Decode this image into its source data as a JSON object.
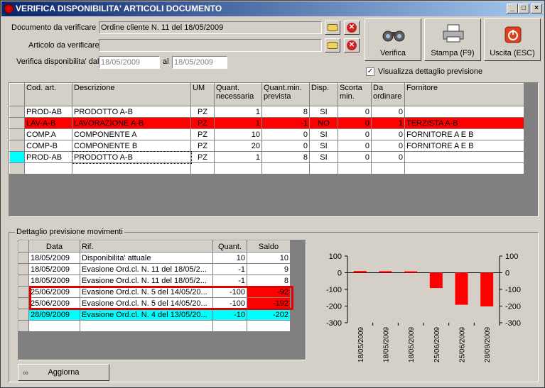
{
  "window": {
    "title": "VERIFICA DISPONIBILITA' ARTICOLI DOCUMENTO"
  },
  "form": {
    "documento_label": "Documento da verificare",
    "documento_value": "Ordine cliente N. 11 del 18/05/2009",
    "articolo_label": "Articolo da verificare",
    "articolo_value": "",
    "verifica_label": "Verifica disponibilita' dal",
    "date_from": "18/05/2009",
    "al_label": "al",
    "date_to": "18/05/2009"
  },
  "buttons": {
    "verifica": "Verifica",
    "stampa": "Stampa (F9)",
    "uscita": "Uscita (ESC)",
    "aggiorna": "Aggiorna"
  },
  "checkbox": {
    "label": "Visualizza dettaglio previsione",
    "checked": true
  },
  "grid_articoli": {
    "headers": {
      "cod": "Cod. art.",
      "descr": "Descrizione",
      "um": "UM",
      "qnec1": "Quant.",
      "qnec2": "necessaria",
      "qprev1": "Quant.min.",
      "qprev2": "prevista",
      "disp": "Disp.",
      "scorta1": "Scorta",
      "scorta2": "min.",
      "ord1": "Da",
      "ord2": "ordinare",
      "forn": "Fornitore"
    },
    "rows": [
      {
        "cod": "PROD-AB",
        "descr": "PRODOTTO A-B",
        "um": "PZ",
        "qnec": "1",
        "qprev": "8",
        "disp": "SI",
        "scorta": "0",
        "ord": "0",
        "forn": ""
      },
      {
        "cod": "LAV-A-B",
        "descr": "LAVORAZIONE A-B",
        "um": "PZ",
        "qnec": "1",
        "qprev": "-1",
        "disp": "NO",
        "scorta": "0",
        "ord": "1",
        "forn": "TERZISTA A-B"
      },
      {
        "cod": "COMP.A",
        "descr": "COMPONENTE A",
        "um": "PZ",
        "qnec": "10",
        "qprev": "0",
        "disp": "SI",
        "scorta": "0",
        "ord": "0",
        "forn": "FORNITORE A E B"
      },
      {
        "cod": "COMP-B",
        "descr": "COMPONENTE B",
        "um": "PZ",
        "qnec": "20",
        "qprev": "0",
        "disp": "SI",
        "scorta": "0",
        "ord": "0",
        "forn": "FORNITORE A E B"
      },
      {
        "cod": "PROD-AB",
        "descr": "PRODOTTO A-B",
        "um": "PZ",
        "qnec": "1",
        "qprev": "8",
        "disp": "SI",
        "scorta": "0",
        "ord": "0",
        "forn": ""
      }
    ]
  },
  "dettaglio": {
    "title": "Dettaglio previsione movimenti",
    "headers": {
      "data": "Data",
      "rif": "Rif.",
      "quant": "Quant.",
      "saldo": "Saldo"
    },
    "rows": [
      {
        "data": "18/05/2009",
        "rif": "Disponibilita' attuale",
        "quant": "10",
        "saldo": "10"
      },
      {
        "data": "18/05/2009",
        "rif": "Evasione Ord.cl. N. 11 del 18/05/2...",
        "quant": "-1",
        "saldo": "9"
      },
      {
        "data": "18/05/2009",
        "rif": "Evasione Ord.cl. N. 11 del 18/05/2...",
        "quant": "-1",
        "saldo": "8"
      },
      {
        "data": "25/06/2009",
        "rif": "Evasione Ord.cl. N. 5 del 14/05/20...",
        "quant": "-100",
        "saldo": "-92"
      },
      {
        "data": "25/06/2009",
        "rif": "Evasione Ord.cl. N. 5 del 14/05/20...",
        "quant": "-100",
        "saldo": "-192"
      },
      {
        "data": "28/09/2009",
        "rif": "Evasione Ord.cl. N. 4 del 13/05/20...",
        "quant": "-10",
        "saldo": "-202"
      }
    ]
  },
  "colors": {
    "negative": "#ff0000",
    "selected": "#00ffff",
    "title_start": "#0a246a"
  },
  "chart_data": {
    "type": "bar",
    "categories": [
      "18/05/2009",
      "18/05/2009",
      "18/05/2009",
      "25/06/2009",
      "25/06/2009",
      "28/09/2009"
    ],
    "values": [
      10,
      9,
      8,
      -92,
      -192,
      -202
    ],
    "ylim": [
      -300,
      100
    ],
    "yticks": [
      "100",
      "0",
      "-100",
      "-200",
      "-300"
    ],
    "color": "#ff0000",
    "grid": false,
    "title": "",
    "xlabel": "",
    "ylabel": ""
  }
}
